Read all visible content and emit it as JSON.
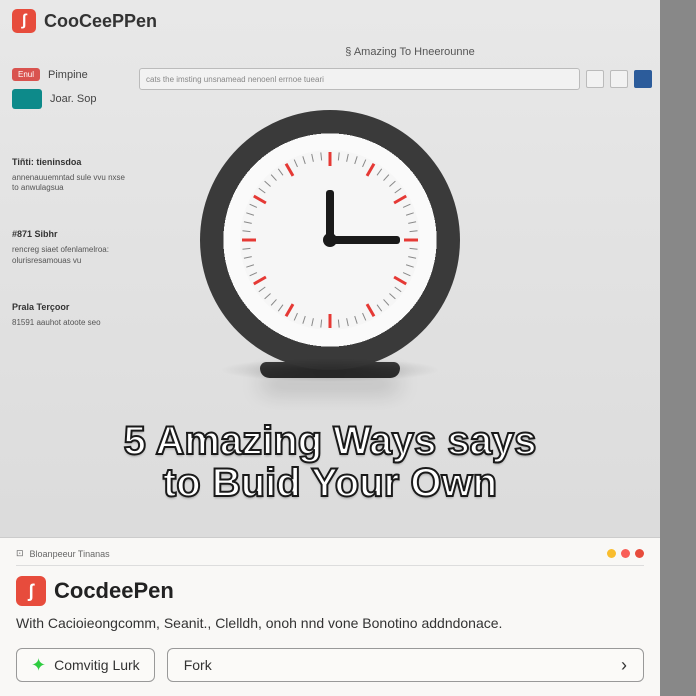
{
  "header": {
    "brand": "CooCeePPen",
    "subtitle": "§ Amazing To Hneerounne"
  },
  "sidebar": {
    "badge_red": "Enul",
    "item1": "Pimpine",
    "item2": "Joar. Sop",
    "sections": [
      {
        "title": "Tiñti: tieninsdoa",
        "body": "annenauuemntad sule vvu nxse to anwulagsua"
      },
      {
        "title": "#871 Sibhr",
        "body": "rencreg siaet ofenlamelroa: olurisresamouas vu"
      },
      {
        "title": "Prala Terçoor",
        "body": "81591 aauhot atoote seo"
      }
    ]
  },
  "toolbar": {
    "placeholder": "cats the imsting unsnamead nenoenl errnoe tueari"
  },
  "hero": {
    "line1": "5 Amazing Ways says",
    "line2": "to Buid Your Own"
  },
  "bottom": {
    "tab_text": "Bloanpeeur Tinanas",
    "brand": "CocdeePen",
    "description": "With Cacioieongcomm, Seanit., Clelldh, onoh nnd vone Bonotino addndonace.",
    "btn_copy": "Comvitig Lurk",
    "btn_fork": "Fork"
  },
  "colors": {
    "accent_red": "#e74c3c",
    "accent_teal": "#0d8a8a"
  }
}
